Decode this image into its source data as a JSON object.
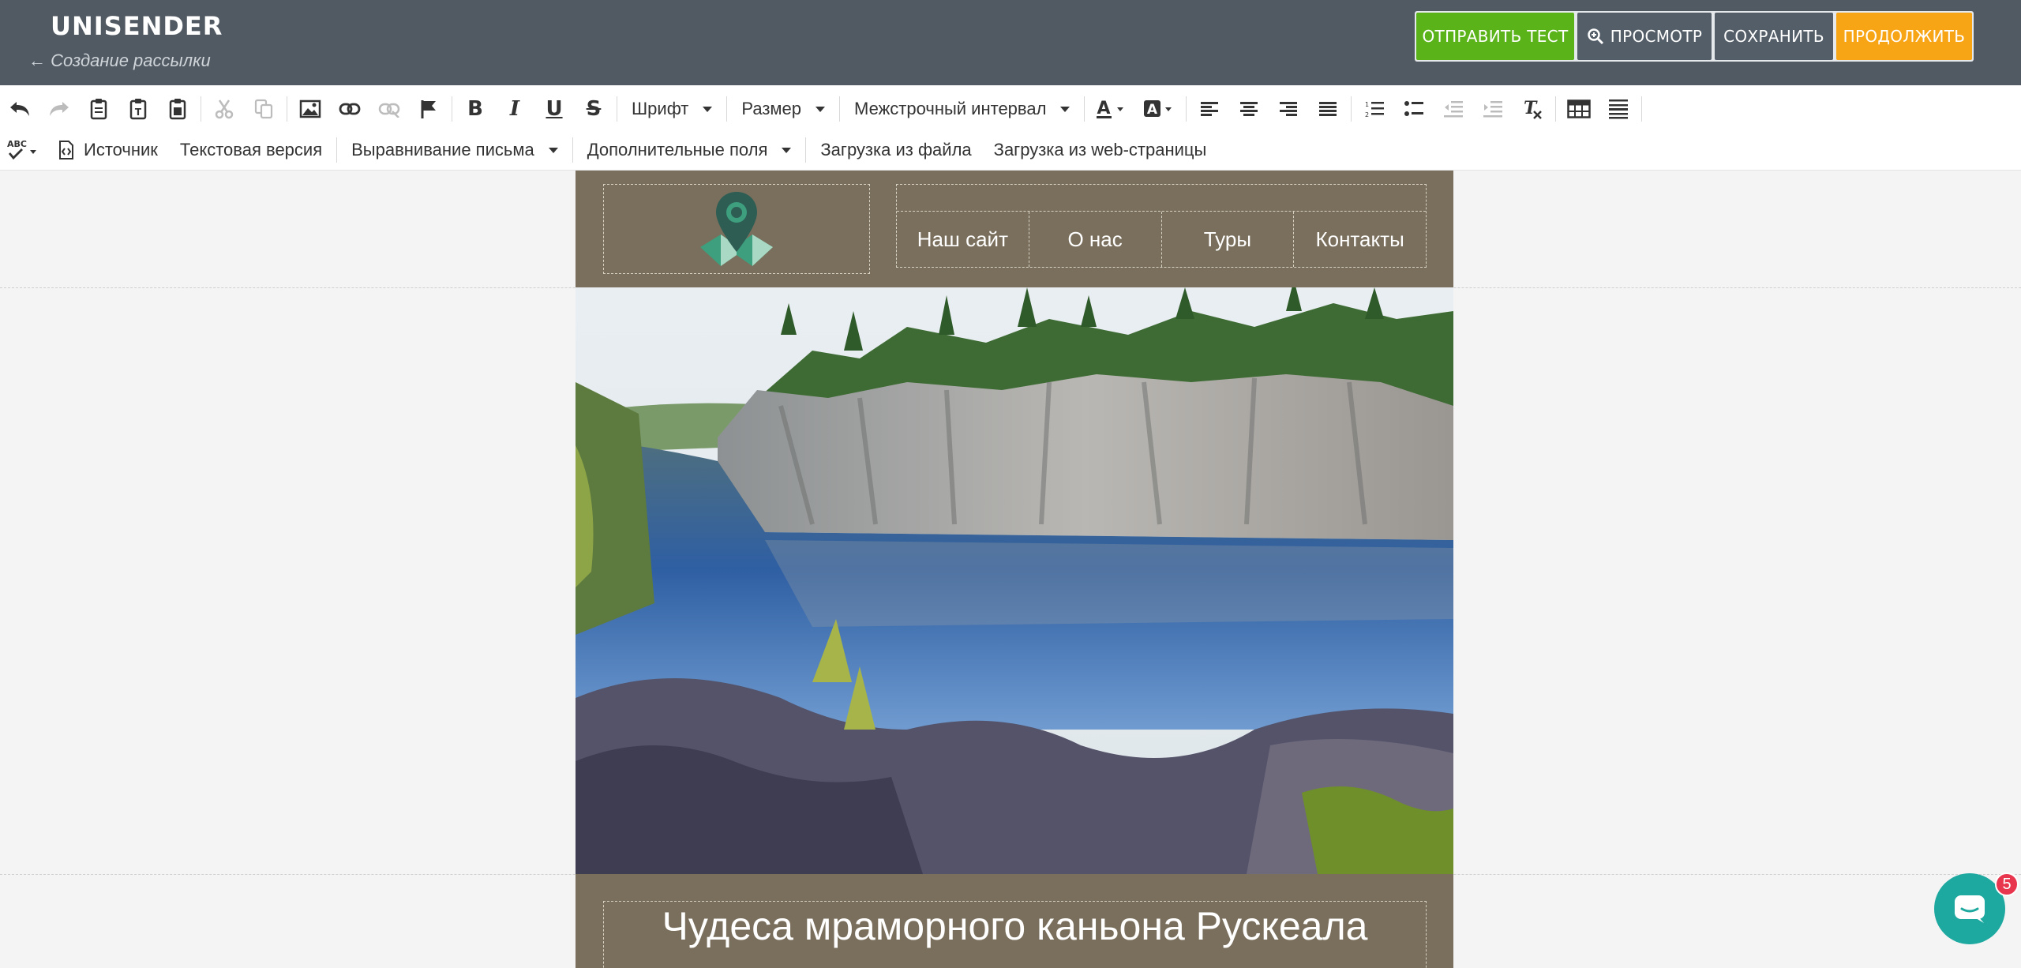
{
  "header": {
    "logo": "UNISENDER",
    "back_link": "← Создание рассылки",
    "buttons": {
      "send_test": "ОТПРАВИТЬ ТЕСТ",
      "preview": "ПРОСМОТР",
      "save": "СОХРАНИТЬ",
      "continue": "ПРОДОЛЖИТЬ"
    }
  },
  "toolbar": {
    "bold": "B",
    "italic": "I",
    "underline": "U",
    "strike": "S",
    "font": "Шрифт",
    "size": "Размер",
    "line_height": "Межстрочный интервал",
    "spellcheck": "ABC",
    "source": "Источник",
    "text_version": "Текстовая версия",
    "letter_align": "Выравнивание письма",
    "extra_fields": "Дополнительные поля",
    "load_file": "Загрузка из файла",
    "load_web": "Загрузка из web-страницы"
  },
  "email": {
    "nav": [
      "Наш сайт",
      "О нас",
      "Туры",
      "Контакты"
    ],
    "title": "Чудеса мраморного каньона Рускеала"
  },
  "chat": {
    "badge": "5"
  },
  "colors": {
    "topbar": "#515a63",
    "send_test": "#5bb31a",
    "continue": "#f7a415",
    "email_bg": "#7a6f5c",
    "chat": "#1ea9a0"
  }
}
